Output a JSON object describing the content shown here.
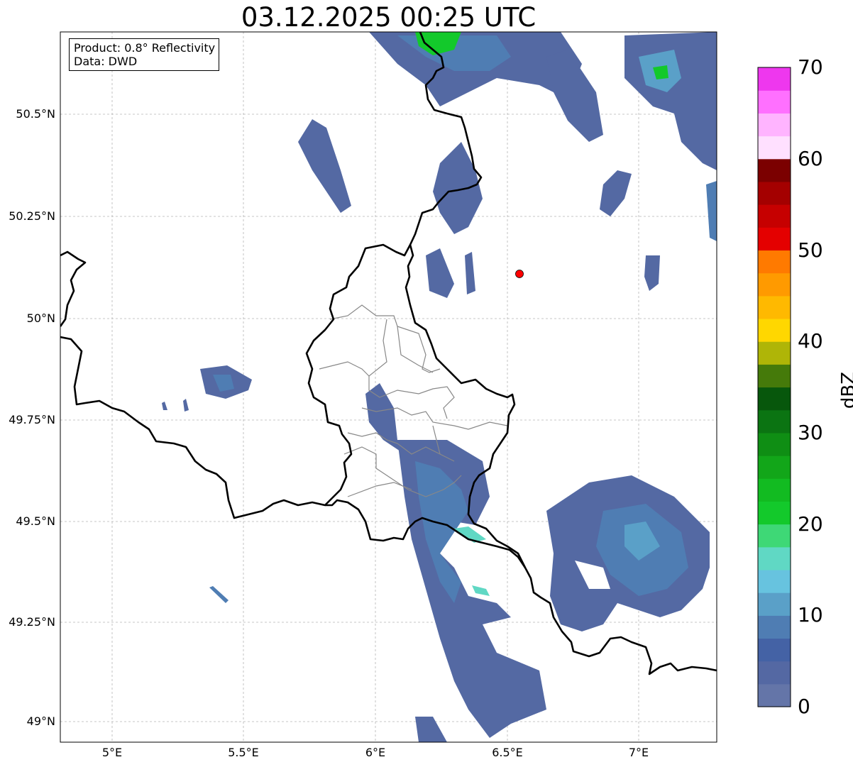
{
  "title": "03.12.2025 00:25 UTC",
  "info_box": {
    "product": "Product: 0.8° Reflectivity",
    "data_source": "Data: DWD"
  },
  "axes": {
    "lon_ticks": [
      "5°E",
      "5.5°E",
      "6°E",
      "6.5°E",
      "7°E"
    ],
    "lat_ticks": [
      "50.5°N",
      "50.25°N",
      "50°N",
      "49.75°N",
      "49.5°N",
      "49.25°N",
      "49°N"
    ],
    "grid": true
  },
  "marker": {
    "label": "radar-site-marker",
    "color": "#ff0000"
  },
  "colorbar": {
    "label": "dBZ",
    "ticks": [
      "0",
      "10",
      "20",
      "30",
      "40",
      "50",
      "60",
      "70"
    ],
    "colors": [
      "#6475a8",
      "#5468a3",
      "#4462a5",
      "#4f7db3",
      "#5aa0c8",
      "#67c3df",
      "#60d8c4",
      "#3ed876",
      "#13c92b",
      "#12bb21",
      "#12a619",
      "#0f8e14",
      "#0b7412",
      "#07570c",
      "#457a0a",
      "#afb507",
      "#ffd700",
      "#ffb900",
      "#ff9a00",
      "#ff7a00",
      "#e40000",
      "#c60000",
      "#a40000",
      "#7b0000",
      "#ffe0ff",
      "#ffb4ff",
      "#ff70ff",
      "#ee37ee"
    ]
  }
}
